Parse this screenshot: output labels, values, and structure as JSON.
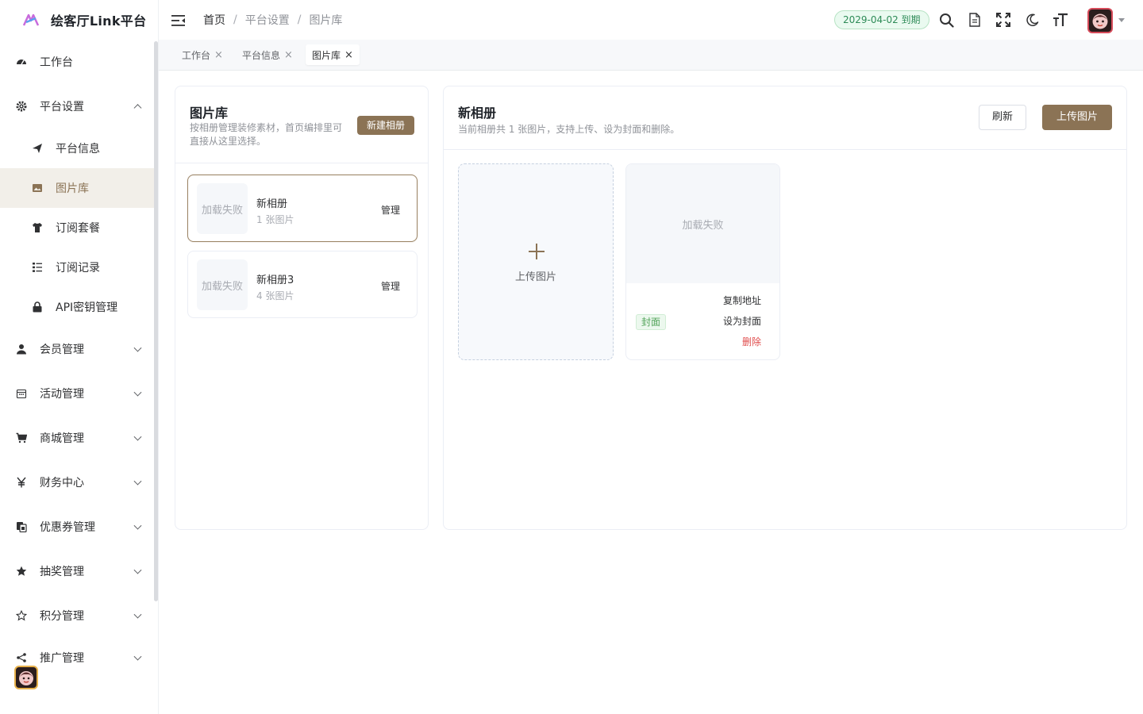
{
  "app": {
    "title": "绘客厅Link平台"
  },
  "sidebar": {
    "items": [
      {
        "label": "工作台",
        "icon": "dashboard-icon"
      },
      {
        "label": "平台设置",
        "icon": "gear-icon",
        "expanded": true,
        "children": [
          {
            "label": "平台信息",
            "icon": "send-icon"
          },
          {
            "label": "图片库",
            "icon": "image-icon",
            "active": true
          },
          {
            "label": "订阅套餐",
            "icon": "shirt-icon"
          },
          {
            "label": "订阅记录",
            "icon": "list-icon"
          },
          {
            "label": "API密钥管理",
            "icon": "lock-icon"
          }
        ]
      },
      {
        "label": "会员管理",
        "icon": "user-icon"
      },
      {
        "label": "活动管理",
        "icon": "calendar-icon"
      },
      {
        "label": "商城管理",
        "icon": "cart-icon"
      },
      {
        "label": "财务中心",
        "icon": "yen-icon"
      },
      {
        "label": "优惠券管理",
        "icon": "coupon-icon"
      },
      {
        "label": "抽奖管理",
        "icon": "star-filled-icon"
      },
      {
        "label": "积分管理",
        "icon": "star-outline-icon"
      },
      {
        "label": "推广管理",
        "icon": "share-icon"
      }
    ]
  },
  "header": {
    "breadcrumb": [
      "首页",
      "平台设置",
      "图片库"
    ],
    "breadcrumb_sep": "/",
    "expire_badge": "2029-04-02 到期",
    "icons": [
      "search-icon",
      "document-icon",
      "fullscreen-icon",
      "moon-icon",
      "font-size-icon"
    ]
  },
  "tabs": [
    {
      "label": "工作台",
      "close": "×"
    },
    {
      "label": "平台信息",
      "close": "×"
    },
    {
      "label": "图片库",
      "close": "×",
      "active": true
    }
  ],
  "albums_panel": {
    "title": "图片库",
    "description": "按相册管理装修素材，首页编排里可直接从这里选择。",
    "new_button": "新建相册",
    "albums": [
      {
        "thumb_text": "加载失败",
        "name": "新相册",
        "count": "1 张图片",
        "action": "管理",
        "selected": true
      },
      {
        "thumb_text": "加载失败",
        "name": "新相册3",
        "count": "4 张图片",
        "action": "管理",
        "selected": false
      }
    ]
  },
  "album_detail": {
    "title": "新相册",
    "description": "当前相册共 1 张图片，支持上传、设为封面和删除。",
    "refresh_button": "刷新",
    "upload_button": "上传图片",
    "upload_card_label": "上传图片",
    "photos": [
      {
        "image_text": "加载失败",
        "cover_tag": "封面",
        "copy_label": "复制地址",
        "set_cover_label": "设为封面",
        "delete_label": "删除"
      }
    ]
  },
  "colors": {
    "accent": "#8b7355",
    "danger": "#e04c4c",
    "success": "#52a35a"
  }
}
